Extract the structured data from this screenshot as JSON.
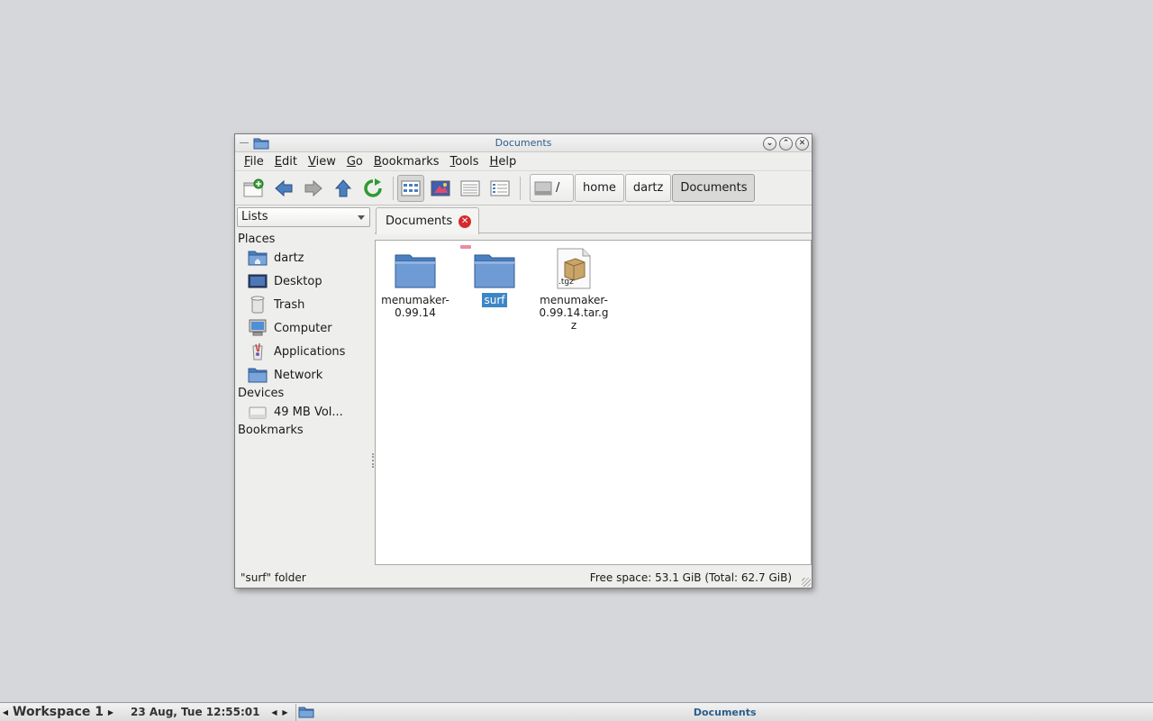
{
  "window": {
    "title": "Documents",
    "buttons": {
      "shade": "⌄",
      "maximize": "⌃",
      "close": "✕"
    }
  },
  "menu": {
    "items": [
      {
        "accel": "F",
        "rest": "ile"
      },
      {
        "accel": "E",
        "rest": "dit"
      },
      {
        "accel": "V",
        "rest": "iew"
      },
      {
        "accel": "G",
        "rest": "o"
      },
      {
        "accel": "B",
        "rest": "ookmarks"
      },
      {
        "accel": "T",
        "rest": "ools"
      },
      {
        "accel": "H",
        "rest": "elp"
      }
    ]
  },
  "toolbar": {
    "icons": [
      "new-tab-icon",
      "back-arrow-icon",
      "forward-arrow-icon",
      "up-arrow-icon",
      "reload-icon",
      "icon-view-icon",
      "thumbnail-view-icon",
      "compact-view-icon",
      "detailed-list-view-icon"
    ]
  },
  "breadcrumb": {
    "root": "/",
    "segments": [
      "home",
      "dartz",
      "Documents"
    ]
  },
  "sidebar": {
    "mode": "Lists",
    "places_header": "Places",
    "places": [
      "dartz",
      "Desktop",
      "Trash",
      "Computer",
      "Applications",
      "Network"
    ],
    "devices_header": "Devices",
    "devices": [
      "49 MB Vol..."
    ],
    "bookmarks_header": "Bookmarks"
  },
  "tab": {
    "label": "Documents"
  },
  "files": [
    {
      "name": "menumaker-0.99.14",
      "type": "folder",
      "selected": false
    },
    {
      "name": "surf",
      "type": "folder",
      "selected": true
    },
    {
      "name": "menumaker-0.99.14.tar.gz",
      "type": "archive",
      "badge": ".tgz",
      "selected": false
    }
  ],
  "status": {
    "left": "\"surf\" folder",
    "right": "Free space: 53.1 GiB (Total: 62.7 GiB)"
  },
  "taskbar": {
    "workspace": "Workspace 1",
    "clock": "23 Aug, Tue 12:55:01",
    "task_title": "Documents"
  },
  "colors": {
    "folder": "#5b8cc8",
    "selection": "#3d86c6",
    "title_text": "#2a5d8a",
    "close_badge": "#d42b2b"
  }
}
